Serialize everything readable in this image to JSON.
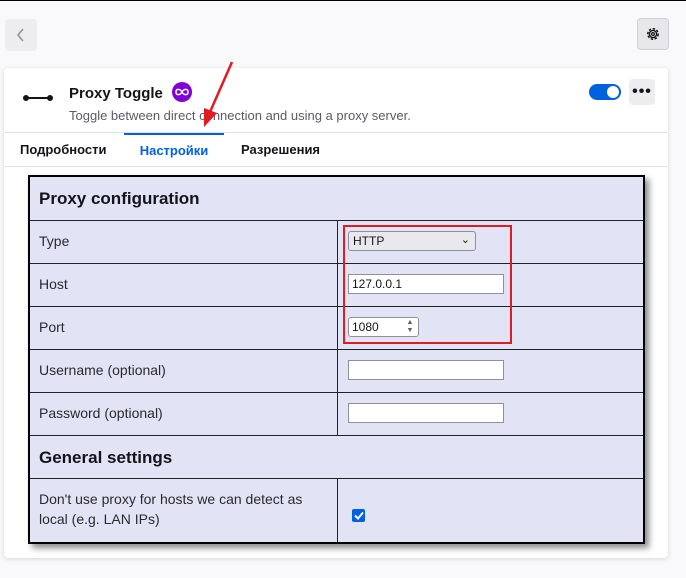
{
  "header": {
    "back_icon": "chevron-left-icon",
    "settings_icon": "gear-icon"
  },
  "addon": {
    "name": "Proxy Toggle",
    "description": "Toggle between direct connection and using a proxy server.",
    "badge_icon": "infinity-icon",
    "enabled": true,
    "more_label": "•••"
  },
  "tabs": [
    {
      "label": "Подробности",
      "active": false
    },
    {
      "label": "Настройки",
      "active": true
    },
    {
      "label": "Разрешения",
      "active": false
    }
  ],
  "proxy_section": {
    "title": "Proxy configuration",
    "type_label": "Type",
    "type_value": "HTTP",
    "host_label": "Host",
    "host_value": "127.0.0.1",
    "port_label": "Port",
    "port_value": "1080",
    "username_label": "Username (optional)",
    "username_value": "",
    "password_label": "Password (optional)",
    "password_value": ""
  },
  "general_section": {
    "title": "General settings",
    "local_label_line1": "Don't use proxy for hosts we can detect as",
    "local_label_line2": "local (e.g. LAN IPs)",
    "local_checked": true
  },
  "colors": {
    "accent": "#0061e0",
    "annotation_red": "#e01b24",
    "table_bg": "#e3e3f6"
  }
}
